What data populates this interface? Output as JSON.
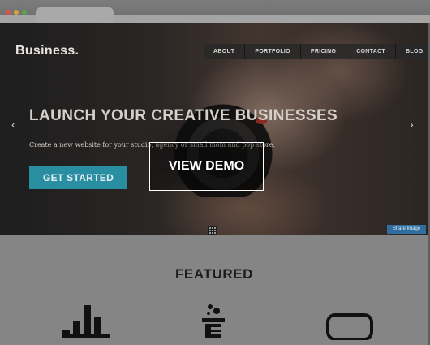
{
  "browser": {
    "window_buttons": [
      "red",
      "yellow",
      "green"
    ]
  },
  "site": {
    "logo": "Business.",
    "nav": [
      "ABOUT",
      "PORTFOLIO",
      "PRICING",
      "CONTACT",
      "BLOG"
    ]
  },
  "hero": {
    "headline": "LAUNCH YOUR CREATIVE BUSINESSES",
    "subtext": "Create a new website for your studio, agency or small mom and pop store.",
    "cta_label": "GET STARTED",
    "prev_arrow": "‹",
    "next_arrow": "›",
    "share_label": "Share Image"
  },
  "overlay": {
    "label": "VIEW DEMO"
  },
  "featured": {
    "title": "FEATURED",
    "icons": [
      "bar-chart-icon",
      "bottle-icon",
      "rounded-square-icon"
    ]
  },
  "colors": {
    "accent": "#2a8ea3",
    "share": "#2f6e9e",
    "featured_bg": "#858585"
  }
}
